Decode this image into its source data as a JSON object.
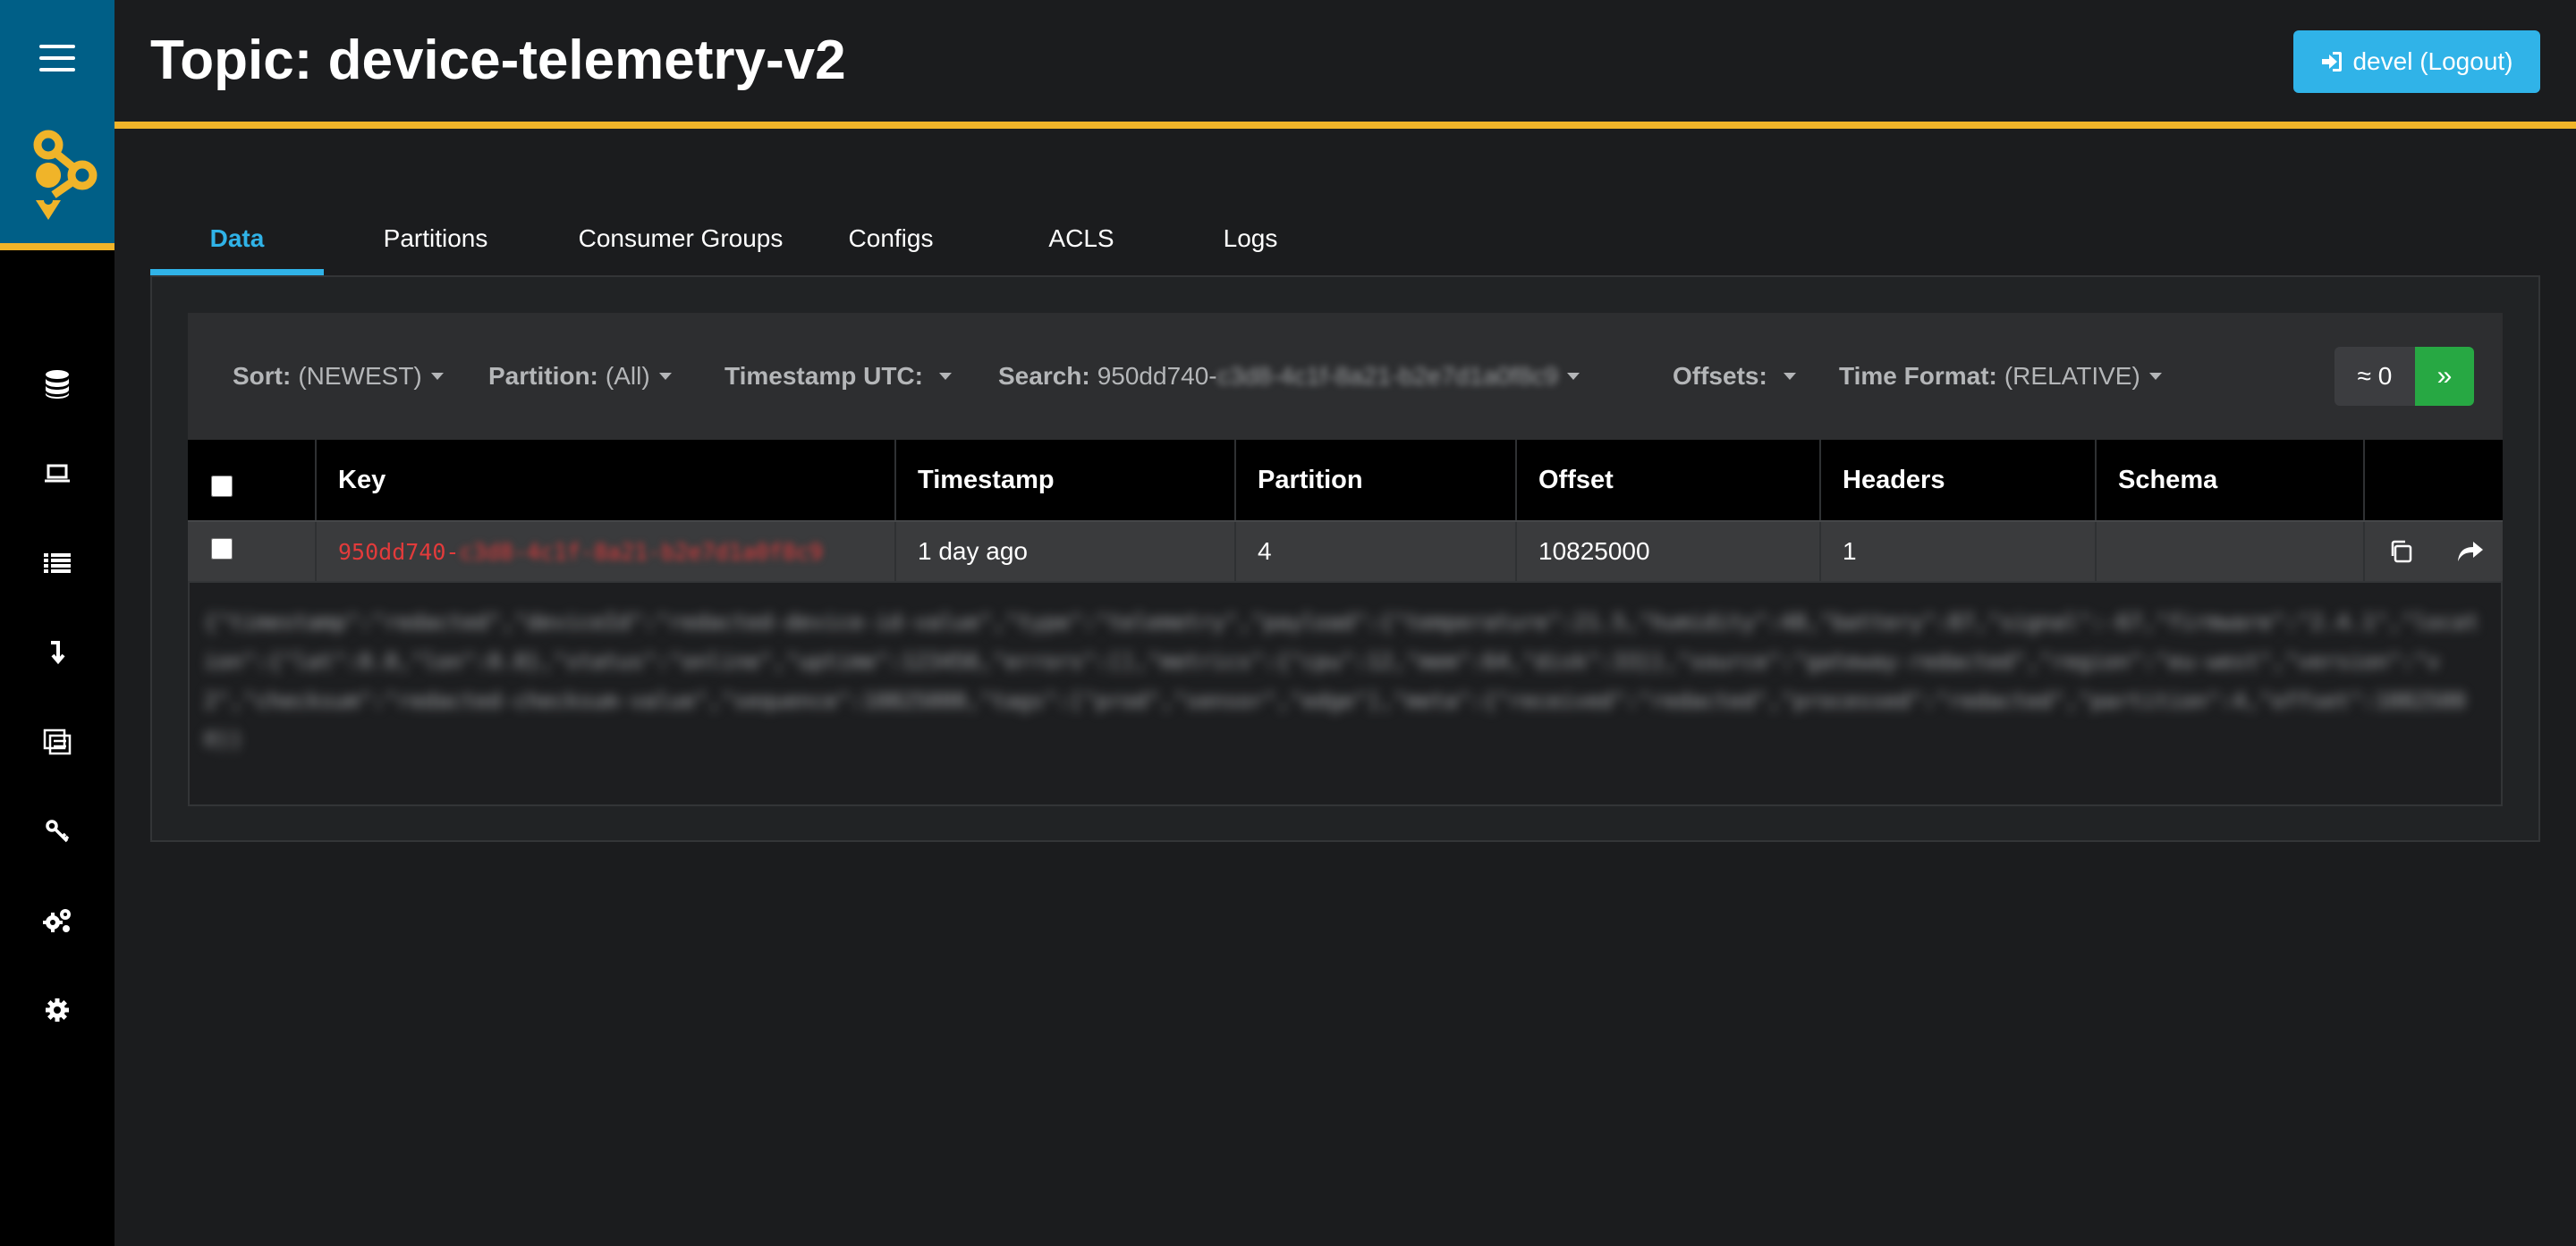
{
  "header": {
    "title": "Topic: device-telemetry-v2",
    "logout_label": "devel (Logout)"
  },
  "sidebar": {
    "items": [
      {
        "icon": "database-icon",
        "name": "nodes"
      },
      {
        "icon": "laptop-icon",
        "name": "topics"
      },
      {
        "icon": "list-icon",
        "name": "tail"
      },
      {
        "icon": "arrow-down-icon",
        "name": "consumer-groups"
      },
      {
        "icon": "schema-icon",
        "name": "schema-registry"
      },
      {
        "icon": "key-icon",
        "name": "acls"
      },
      {
        "icon": "gears-icon",
        "name": "connect"
      },
      {
        "icon": "settings-icon",
        "name": "settings"
      }
    ]
  },
  "tabs": [
    {
      "label": "Data",
      "active": true
    },
    {
      "label": "Partitions"
    },
    {
      "label": "Consumer Groups"
    },
    {
      "label": "Configs"
    },
    {
      "label": "ACLS"
    },
    {
      "label": "Logs"
    }
  ],
  "filters": {
    "sort": {
      "label": "Sort:",
      "value": "(NEWEST)"
    },
    "partition": {
      "label": "Partition:",
      "value": "(All)"
    },
    "timestamp": {
      "label": "Timestamp UTC:",
      "value": ""
    },
    "search": {
      "label": "Search:",
      "value": "950dd740-",
      "redacted": "c3d8-4c1f-8a21-b2e7d1a0f8c9"
    },
    "offsets": {
      "label": "Offsets:",
      "value": ""
    },
    "time_format": {
      "label": "Time Format:",
      "value": "(RELATIVE)"
    }
  },
  "pager": {
    "count": "≈ 0",
    "next": "»"
  },
  "table": {
    "columns": [
      "Key",
      "Timestamp",
      "Partition",
      "Offset",
      "Headers",
      "Schema"
    ],
    "rows": [
      {
        "key": "950dd740-",
        "key_redacted": "c3d8-4c1f-8a21-b2e7d1a0f8c9",
        "timestamp": "1 day ago",
        "partition": "4",
        "offset": "10825000",
        "headers": "1",
        "schema": "",
        "value_redacted": "{\"timestamp\":\"redacted\",\"deviceId\":\"redacted-device-id-value\",\"type\":\"telemetry\",\"payload\":{\"temperature\":21.5,\"humidity\":48,\"battery\":87,\"signal\":-67,\"firmware\":\"2.4.1\",\"location\":{\"lat\":0.0,\"lon\":0.0},\"status\":\"online\",\"uptime\":123456,\"errors\":[],\"metrics\":{\"cpu\":12,\"mem\":64,\"disk\":33}},\"source\":\"gateway-redacted\",\"region\":\"eu-west\",\"version\":\"v2\",\"checksum\":\"redacted-checksum-value\",\"sequence\":10825000,\"tags\":[\"prod\",\"sensor\",\"edge\"],\"meta\":{\"received\":\"redacted\",\"processed\":\"redacted\",\"partition\":4,\"offset\":10825000}}"
      }
    ]
  },
  "colors": {
    "accent": "#30b3e8",
    "brand_yellow": "#f0b429",
    "sidebar_top": "#005f87",
    "next_button": "#27a843",
    "key_text": "#e23b3b"
  }
}
